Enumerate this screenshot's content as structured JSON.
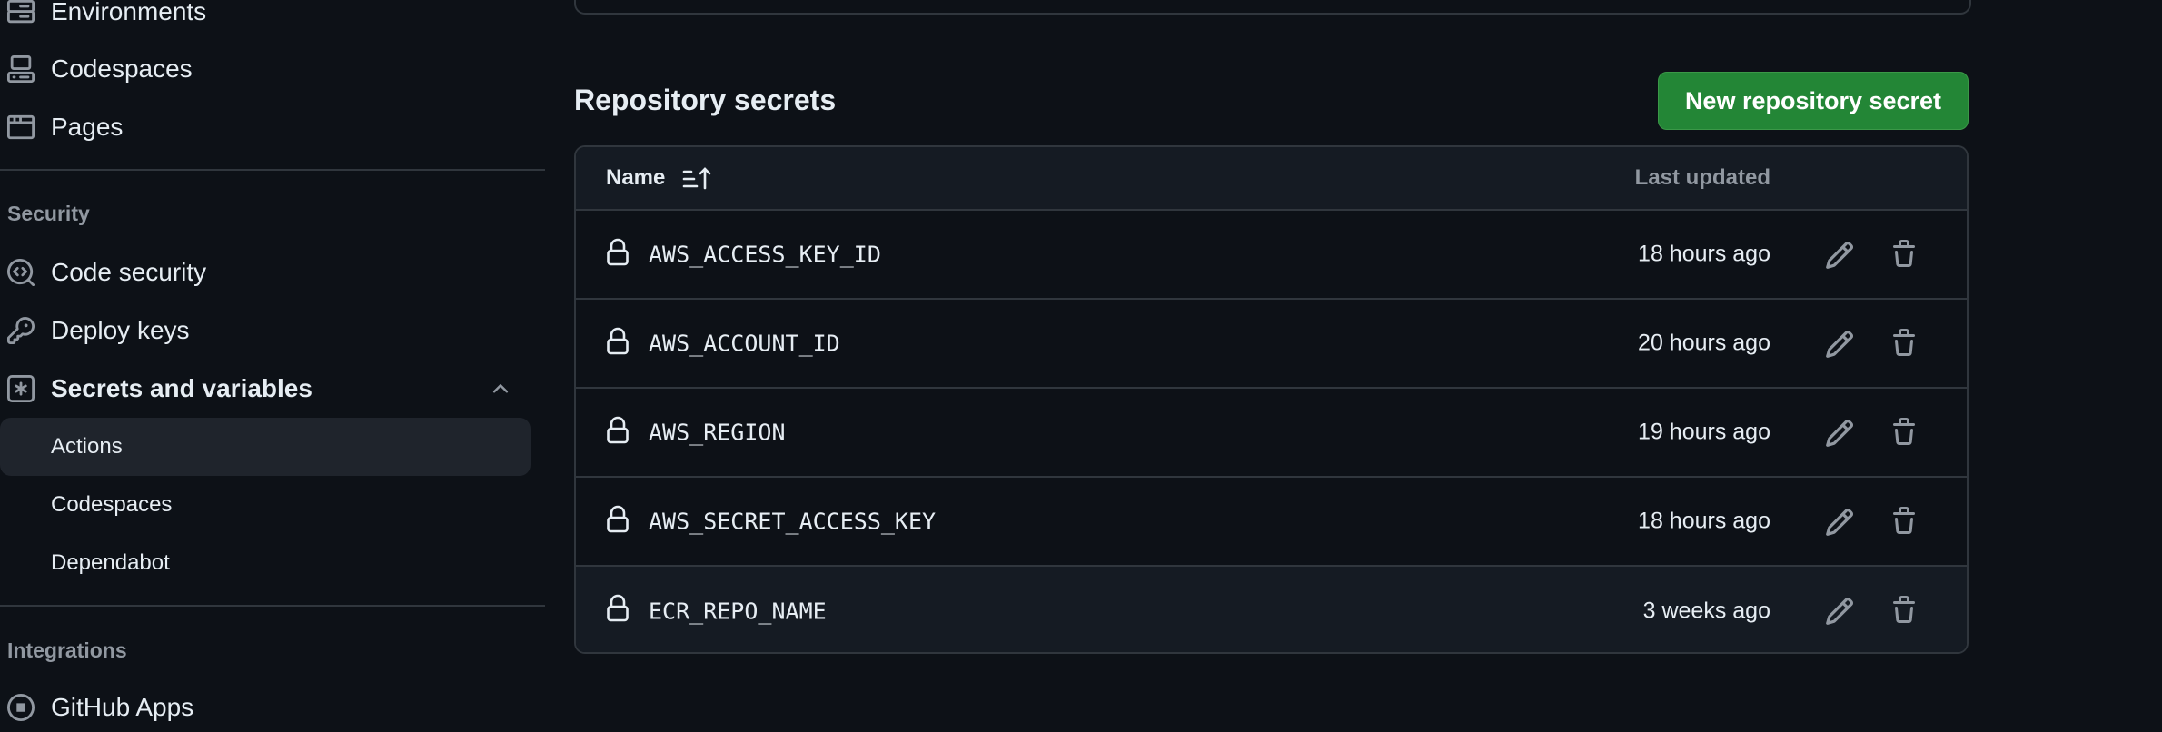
{
  "sidebar": {
    "items_top": [
      {
        "label": "Environments",
        "icon": "server-icon"
      },
      {
        "label": "Codespaces",
        "icon": "codespaces-icon"
      },
      {
        "label": "Pages",
        "icon": "browser-icon"
      }
    ],
    "security_heading": "Security",
    "security_items": [
      {
        "label": "Code security",
        "icon": "codescan-icon"
      },
      {
        "label": "Deploy keys",
        "icon": "key-icon"
      },
      {
        "label": "Secrets and variables",
        "icon": "key-asterisk-icon"
      }
    ],
    "secrets_subitems": [
      {
        "label": "Actions",
        "active": true
      },
      {
        "label": "Codespaces",
        "active": false
      },
      {
        "label": "Dependabot",
        "active": false
      }
    ],
    "integrations_heading": "Integrations",
    "integrations_items": [
      {
        "label": "GitHub Apps",
        "icon": "apps-icon"
      }
    ]
  },
  "main": {
    "section_title": "Repository secrets",
    "new_secret_button": "New repository secret",
    "table": {
      "col_name": "Name",
      "col_updated": "Last updated",
      "rows": [
        {
          "name": "AWS_ACCESS_KEY_ID",
          "updated": "18 hours ago"
        },
        {
          "name": "AWS_ACCOUNT_ID",
          "updated": "20 hours ago"
        },
        {
          "name": "AWS_REGION",
          "updated": "19 hours ago"
        },
        {
          "name": "AWS_SECRET_ACCESS_KEY",
          "updated": "18 hours ago"
        },
        {
          "name": "ECR_REPO_NAME",
          "updated": "3 weeks ago"
        }
      ]
    }
  },
  "colors": {
    "background": "#0d1117",
    "accent_button": "#238636",
    "border": "#30363d",
    "muted_text": "#9198a1"
  }
}
